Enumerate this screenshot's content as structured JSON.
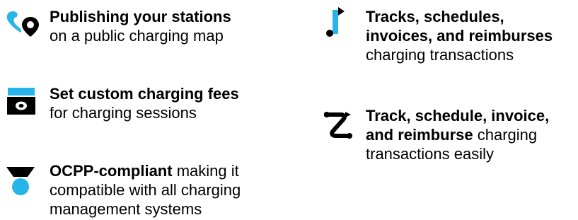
{
  "colors": {
    "accent": "#27b4e8",
    "text": "#000000",
    "background": "#ffffff"
  },
  "features": [
    {
      "icon": "map-pin-icon",
      "bold": "Publishing your stations",
      "text": "on a public charging map"
    },
    {
      "icon": "credit-card-icon",
      "bold": "Set custom charging fees",
      "text": "for charging sessions"
    },
    {
      "icon": "medal-icon",
      "bold": "OCPP-compliant",
      "text_inline": " making it",
      "text_line2": "compatible with all charging",
      "text_line3": "management systems"
    },
    {
      "icon": "music-note-icon",
      "bold_line1": "Tracks, schedules,",
      "bold_line2": "invoices, and reimburses",
      "text": "charging transactions"
    },
    {
      "icon": "route-icon",
      "bold_line1": "Track, schedule, invoice,",
      "bold_line2": "and reimburse",
      "text_inline": " charging",
      "text_line3": "transactions easily"
    }
  ]
}
